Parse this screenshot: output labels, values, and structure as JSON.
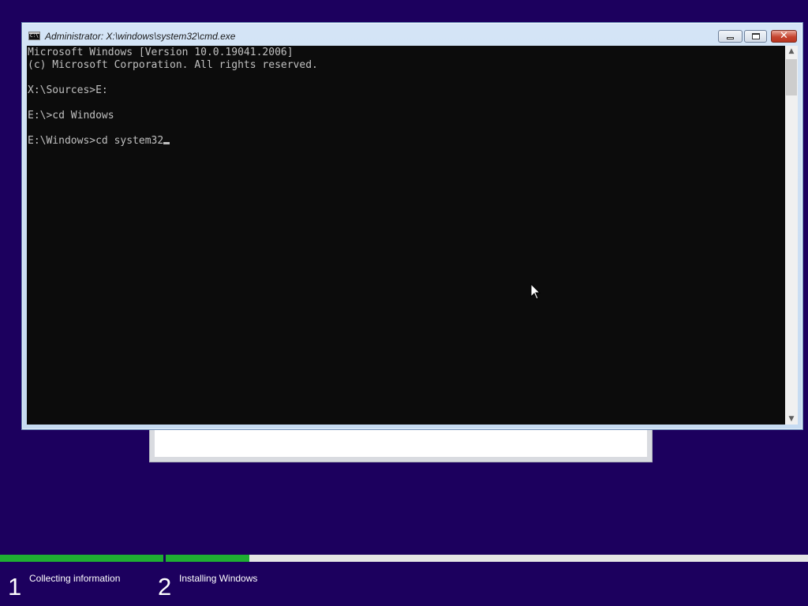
{
  "window": {
    "title": "Administrator: X:\\windows\\system32\\cmd.exe",
    "icon_text": "C:\\",
    "icon": "cmd-icon",
    "buttons": {
      "minimize": "minimize-icon",
      "maximize": "maximize-icon",
      "close": "✕"
    }
  },
  "console": {
    "lines": [
      "Microsoft Windows [Version 10.0.19041.2006]",
      "(c) Microsoft Corporation. All rights reserved.",
      "",
      "X:\\Sources>E:",
      "",
      "E:\\>cd Windows",
      "",
      "E:\\Windows>cd system32"
    ],
    "text_color": "#c0c0c0",
    "background": "#0c0c0c"
  },
  "scrollbar": {
    "up_arrow": "▲",
    "down_arrow": "▼"
  },
  "setup": {
    "steps": [
      {
        "number": "1",
        "label": "Collecting information",
        "progress": 1.0
      },
      {
        "number": "2",
        "label": "Installing Windows",
        "progress": 0.13
      }
    ],
    "progress_color": "#1fae32",
    "background": "#1c005e"
  }
}
